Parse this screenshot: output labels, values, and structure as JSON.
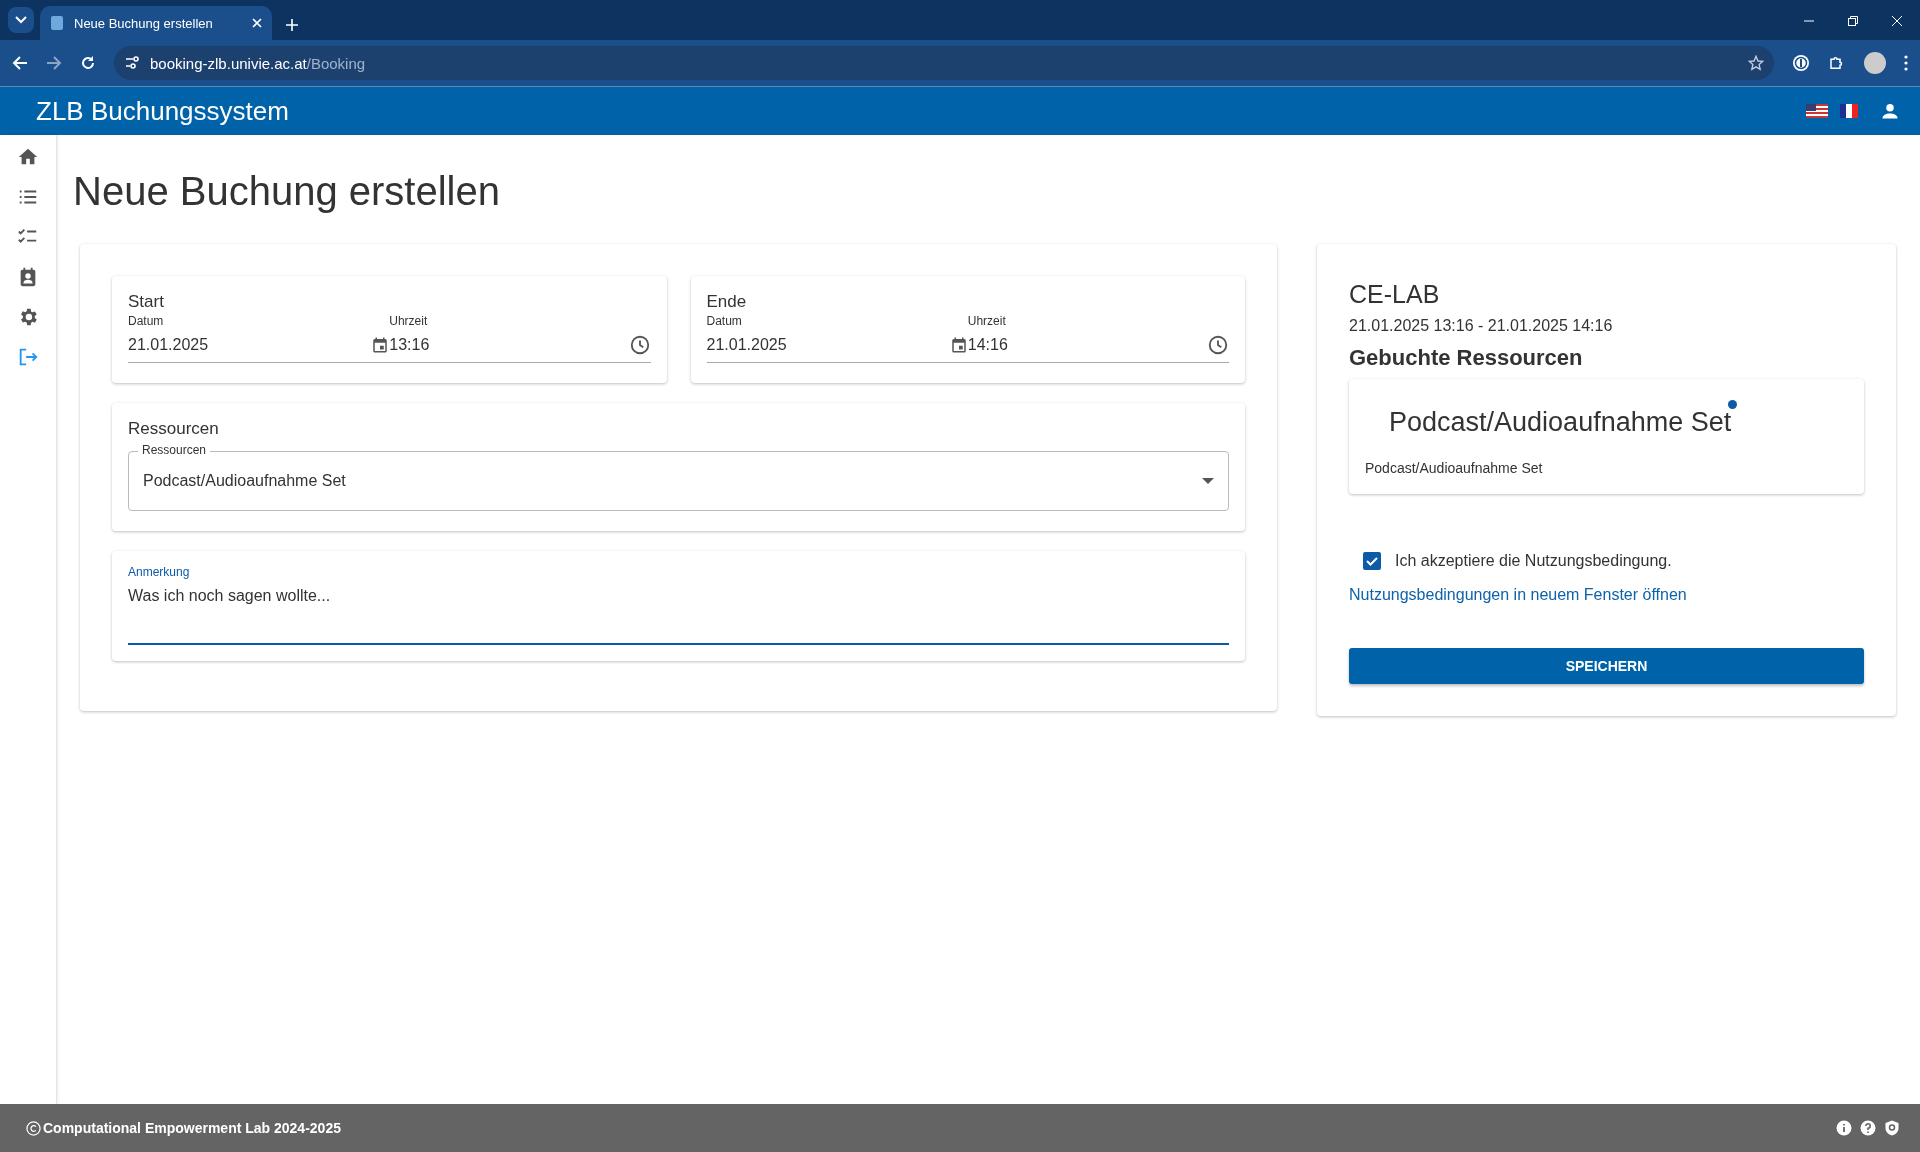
{
  "browser": {
    "tabs": [
      {
        "title": "Neue Buchung erstellen",
        "selected": true
      }
    ],
    "url_host": "booking-zlb.univie.ac.at",
    "url_path": "/Booking"
  },
  "app_bar": {
    "title": "ZLB Buchungssystem"
  },
  "page_title": "Neue Buchung erstellen",
  "start": {
    "heading": "Start",
    "date_label": "Datum",
    "date": "21.01.2025",
    "time_label": "Uhrzeit",
    "time": "13:16"
  },
  "end": {
    "heading": "Ende",
    "date_label": "Datum",
    "date": "21.01.2025",
    "time_label": "Uhrzeit",
    "time": "14:16"
  },
  "resources": {
    "heading": "Ressourcen",
    "select_label": "Ressourcen",
    "value": "Podcast/Audioaufnahme Set"
  },
  "note": {
    "label": "Anmerkung",
    "value": "Was ich noch sagen wollte...",
    "focused": true
  },
  "summary": {
    "lab": "CE-LAB",
    "range": "21.01.2025 13:16 - 21.01.2025 14:16",
    "booked_heading": "Gebuchte Ressourcen",
    "booked": [
      {
        "title": "Podcast/Audioaufnahme Set",
        "subtitle": "Podcast/Audioaufnahme Set"
      }
    ],
    "terms": {
      "label": "Ich akzeptiere die Nutzungsbedingung.",
      "checked": true
    },
    "terms_link": "Nutzungsbedingungen in neuem Fenster öffnen",
    "save": "SPEICHERN"
  },
  "footer": {
    "text": "Computational Empowerment Lab 2024-2025"
  }
}
